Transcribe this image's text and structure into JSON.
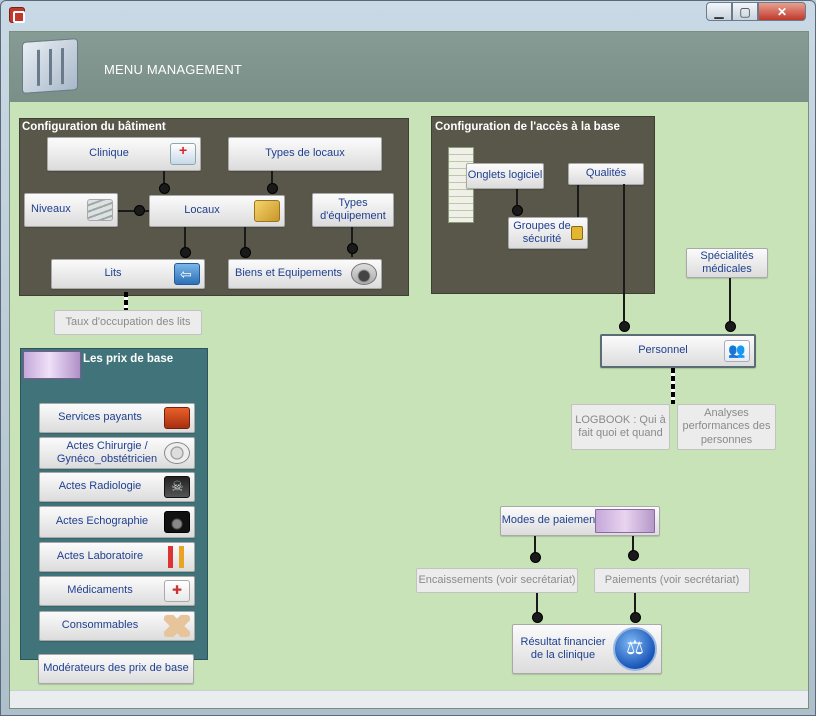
{
  "window": {
    "title": "",
    "controls": {
      "minimize": "▁",
      "maximize": "▢",
      "close": "✕"
    }
  },
  "header": {
    "title": "MENU MANAGEMENT"
  },
  "batiment": {
    "title": "Configuration du bâtiment",
    "clinique": "Clinique",
    "types_locaux": "Types de locaux",
    "niveaux": "Niveaux",
    "locaux": "Locaux",
    "types_equipement": "Types d'équipement",
    "lits": "Lits",
    "biens": "Biens et Equipements"
  },
  "taux_occupation": "Taux d'occupation des lits",
  "acces": {
    "title": "Configuration de l'accès à la base",
    "onglets": "Onglets logiciel",
    "qualites": "Qualités",
    "groupes": "Groupes de sécurité"
  },
  "specialites": "Spécialités médicales",
  "personnel": "Personnel",
  "logbook": "LOGBOOK : Qui à fait quoi et quand",
  "analyses": "Analyses performances des personnes",
  "prix": {
    "title": "Les prix de base",
    "items": [
      {
        "label": "Services payants"
      },
      {
        "label": "Actes Chirurgie / Gynéco_obstétricien"
      },
      {
        "label": "Actes  Radiologie"
      },
      {
        "label": "Actes  Echographie"
      },
      {
        "label": "Actes Laboratoire"
      },
      {
        "label": "Médicaments"
      },
      {
        "label": "Consommables"
      }
    ]
  },
  "moderateurs": "Modérateurs des prix de base",
  "paiement": {
    "modes": "Modes de paiement",
    "encaissements": "Encaissements (voir secrétariat)",
    "paiements": "Paiements (voir secrétariat)",
    "resultat": "Résultat financier de la clinique"
  },
  "colors": {
    "background": "#c8e3b8",
    "header": "#7a8f88",
    "panel_dark": "#59574a",
    "panel_teal": "#41747a",
    "button_text": "#1f3f8f"
  }
}
